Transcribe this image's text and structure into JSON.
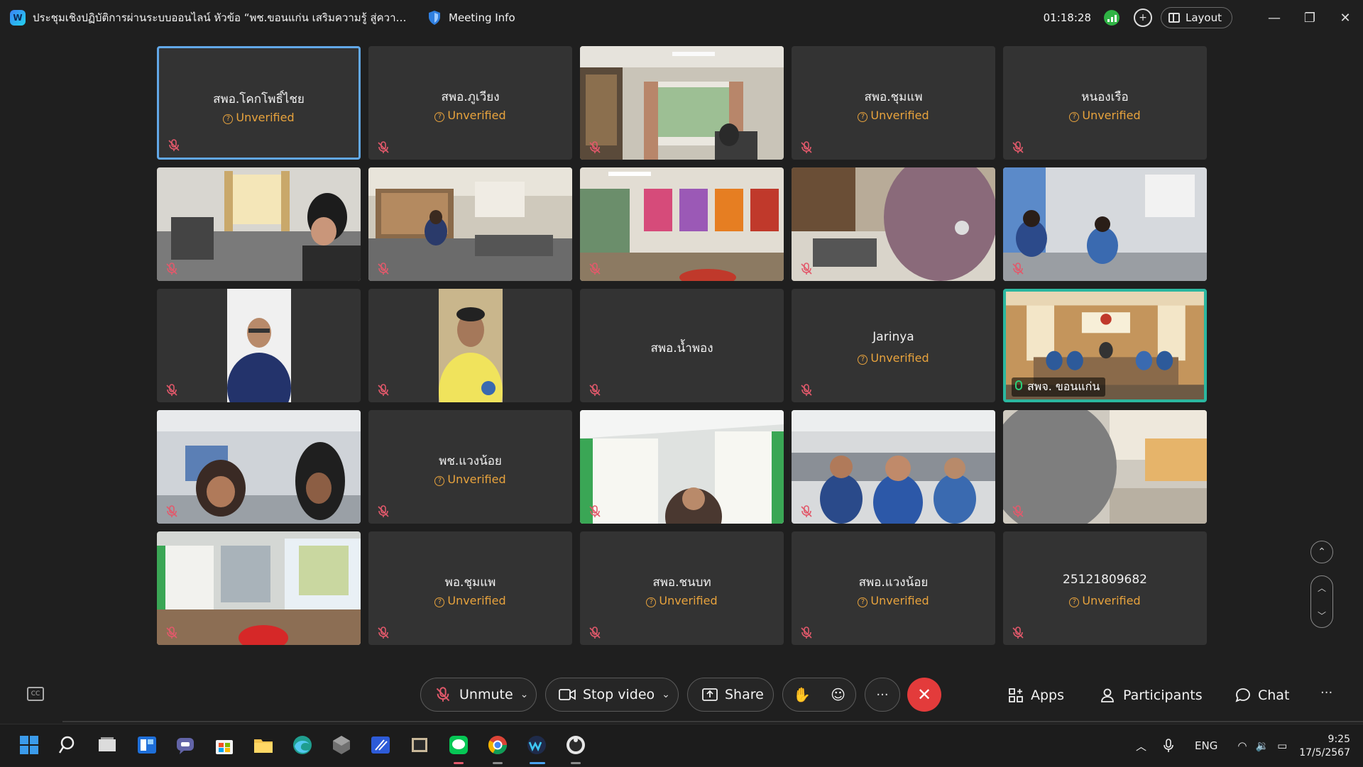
{
  "window": {
    "title": "ประชุมเชิงปฏิบัติการผ่านระบบออนไลน์  หัวข้อ “พช.ขอนแก่น เสริมความรู้ สู่ความเช...",
    "meeting_info_label": "Meeting Info",
    "timer": "01:18:28",
    "layout_label": "Layout"
  },
  "grid": {
    "unverified_label": "Unverified",
    "tiles": [
      {
        "name": "สพอ.โคกโพธิ์ไชย",
        "unverified": true,
        "video": false
      },
      {
        "name": "สพอ.ภูเวียง",
        "unverified": true,
        "video": false
      },
      {
        "name": "",
        "unverified": false,
        "video": true
      },
      {
        "name": "สพอ.ชุมแพ",
        "unverified": true,
        "video": false
      },
      {
        "name": "หนองเรือ",
        "unverified": true,
        "video": false
      },
      {
        "name": "",
        "unverified": false,
        "video": true
      },
      {
        "name": "",
        "unverified": false,
        "video": true
      },
      {
        "name": "",
        "unverified": false,
        "video": true
      },
      {
        "name": "",
        "unverified": false,
        "video": true
      },
      {
        "name": "",
        "unverified": false,
        "video": true
      },
      {
        "name": "",
        "unverified": false,
        "video": true
      },
      {
        "name": "",
        "unverified": false,
        "video": true
      },
      {
        "name": "สพอ.น้ำพอง",
        "unverified": false,
        "video": false
      },
      {
        "name": "Jarinya",
        "unverified": true,
        "video": false
      },
      {
        "name": "สพจ. ขอนแก่น",
        "unverified": false,
        "video": true,
        "speaking": true
      },
      {
        "name": "",
        "unverified": false,
        "video": true
      },
      {
        "name": "พช.แวงน้อย",
        "unverified": true,
        "video": false
      },
      {
        "name": "",
        "unverified": false,
        "video": true
      },
      {
        "name": "",
        "unverified": false,
        "video": true
      },
      {
        "name": "",
        "unverified": false,
        "video": true
      },
      {
        "name": "",
        "unverified": false,
        "video": true
      },
      {
        "name": "พอ.ชุมแพ",
        "unverified": true,
        "video": false
      },
      {
        "name": "สพอ.ชนบท",
        "unverified": true,
        "video": false
      },
      {
        "name": "สพอ.แวงน้อย",
        "unverified": true,
        "video": false
      },
      {
        "name": "25121809682",
        "unverified": true,
        "video": false
      }
    ]
  },
  "controls": {
    "unmute": "Unmute",
    "stop_video": "Stop video",
    "share": "Share",
    "apps": "Apps",
    "participants": "Participants",
    "chat": "Chat"
  },
  "taskbar": {
    "language": "ENG",
    "time": "9:25",
    "date": "17/5/2567"
  },
  "colors": {
    "unverified": "#e8a33d",
    "end_call": "#e33b3b",
    "active_border": "#62a8e8",
    "speaking_border": "#2bb7a0"
  }
}
